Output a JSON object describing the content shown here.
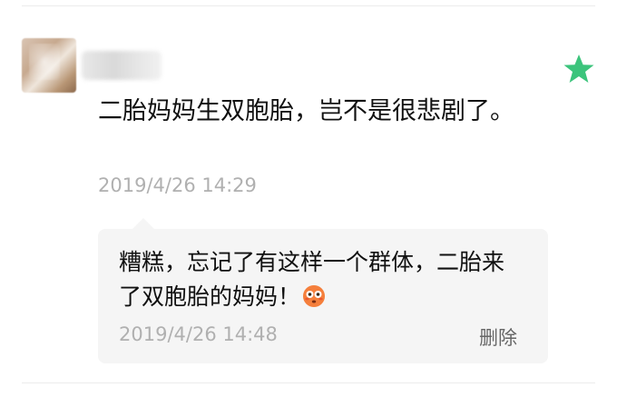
{
  "post": {
    "text": "二胎妈妈生双胞胎，岂不是很悲剧了。",
    "time": "2019/4/26 14:29"
  },
  "comment": {
    "text": "糟糕，忘记了有这样一个群体，二胎来了双胞胎的妈妈！",
    "emoji": "flushed-face-emoji",
    "time": "2019/4/26 14:48",
    "delete_label": "删除"
  },
  "icons": {
    "favorite": "star-icon"
  },
  "colors": {
    "star": "#3cc47c",
    "timestamp": "#b0b0b0",
    "comment_bg": "#f5f5f5",
    "text": "#111111"
  }
}
